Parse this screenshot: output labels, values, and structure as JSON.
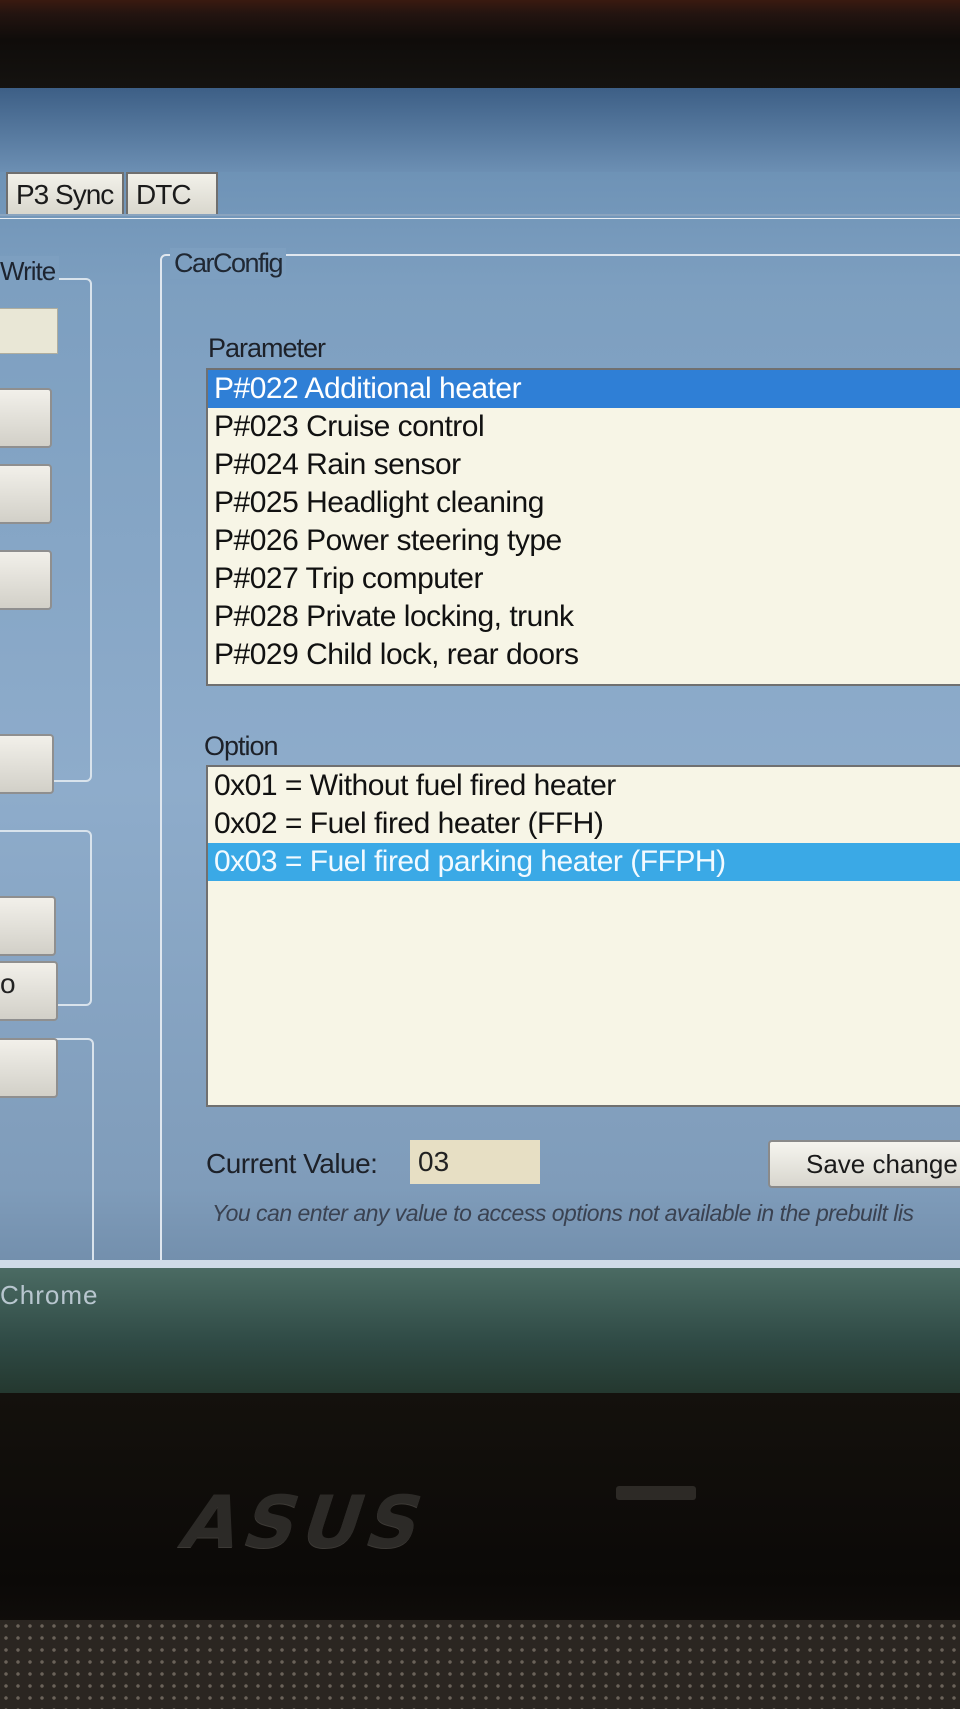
{
  "tabs": [
    {
      "label": "P3 Sync"
    },
    {
      "label": "DTC"
    }
  ],
  "left_panel": {
    "legend": "Write",
    "partial_char": "o"
  },
  "carconfig": {
    "title": "CarConfig",
    "parameter_label": "Parameter",
    "parameters": [
      "P#022 Additional heater",
      "P#023 Cruise control",
      "P#024 Rain sensor",
      "P#025 Headlight cleaning",
      "P#026 Power steering type",
      "P#027 Trip computer",
      "P#028 Private locking, trunk",
      "P#029 Child lock, rear doors"
    ],
    "selected_parameter": "P#022 Additional heater",
    "option_label": "Option",
    "options": [
      "0x01 = Without fuel fired heater",
      "0x02 = Fuel fired heater (FFH)",
      "0x03 = Fuel fired parking heater (FFPH)"
    ],
    "selected_option": "0x03 = Fuel fired parking heater (FFPH)",
    "current_value_label": "Current Value:",
    "current_value": "03",
    "save_label": "Save change",
    "hint": "You can enter any value to access options not available in the prebuilt lis"
  },
  "taskbar": {
    "item_label": "Chrome"
  },
  "bezel": {
    "brand": "ASUS"
  },
  "colors": {
    "selection_primary": "#2f7fd6",
    "selection_secondary": "#3aa9e6",
    "list_background": "#f7f5e6"
  }
}
